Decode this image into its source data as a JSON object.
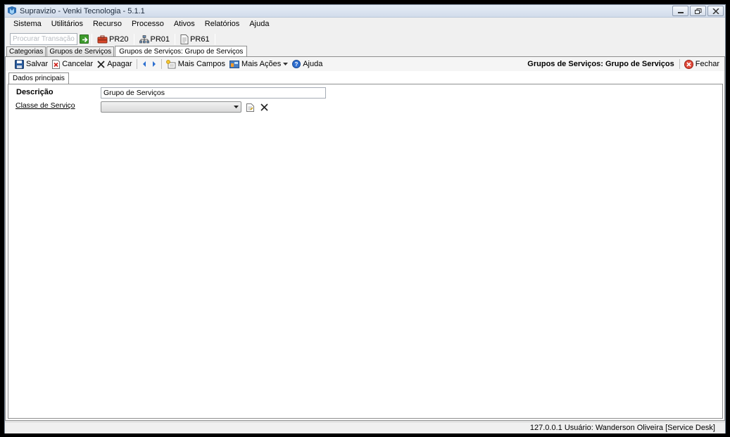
{
  "window": {
    "title": "Supravizio - Venki Tecnologia - 5.1.1"
  },
  "menu": [
    "Sistema",
    "Utilitários",
    "Recurso",
    "Processo",
    "Ativos",
    "Relatórios",
    "Ajuda"
  ],
  "quickbar": {
    "search_placeholder": "Procurar Transação",
    "shortcuts": [
      {
        "label": "PR20",
        "icon": "toolbox-icon"
      },
      {
        "label": "PR01",
        "icon": "org-chart-icon"
      },
      {
        "label": "PR61",
        "icon": "document-icon"
      }
    ]
  },
  "tabs": [
    {
      "label": "Categorias",
      "active": false
    },
    {
      "label": "Grupos de Serviços",
      "active": false
    },
    {
      "label": "Grupos de Serviços: Grupo de Serviços",
      "active": true
    }
  ],
  "toolbar": {
    "save": "Salvar",
    "cancel": "Cancelar",
    "delete": "Apagar",
    "more_fields": "Mais Campos",
    "more_actions": "Mais Ações",
    "help": "Ajuda",
    "doc_title": "Grupos de Serviços: Grupo de Serviços",
    "close": "Fechar"
  },
  "inner_tabs": [
    "Dados principais"
  ],
  "form": {
    "descricao_label": "Descrição",
    "descricao_value": "Grupo de Serviços",
    "classe_label": "Classe de Serviço",
    "classe_value": ""
  },
  "status": {
    "text": "127.0.0.1   Usuário: Wanderson Oliveira [Service Desk]"
  }
}
